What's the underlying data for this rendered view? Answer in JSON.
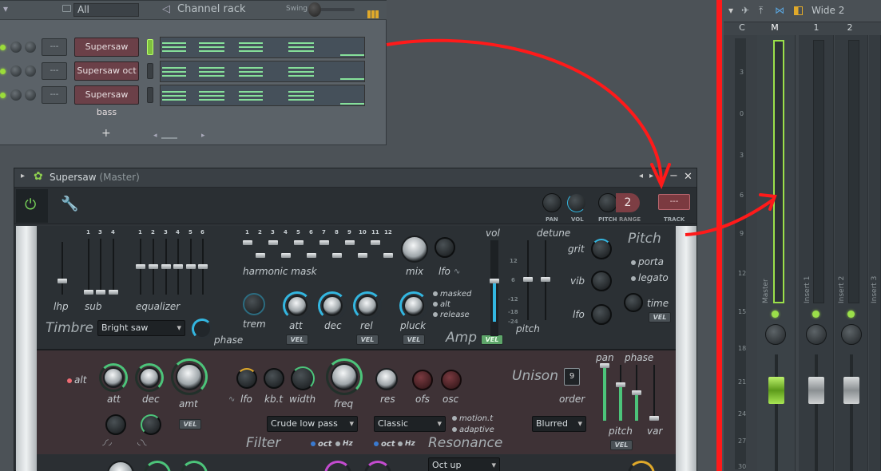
{
  "channel_rack": {
    "filter": "All",
    "title": "Channel rack",
    "swing_label": "Swing",
    "add_label": "+",
    "channels": [
      {
        "mixer_track": "---",
        "name": "Supersaw",
        "selected": true
      },
      {
        "mixer_track": "---",
        "name": "Supersaw oct",
        "selected": false
      },
      {
        "mixer_track": "---",
        "name": "Supersaw bass",
        "selected": false
      }
    ]
  },
  "plugin": {
    "name": "Supersaw",
    "context": "(Master)",
    "toolbar": {
      "pan_label": "PAN",
      "vol_label": "VOL",
      "pitch_label": "PITCH",
      "range_label": "RANGE",
      "range_value": "2",
      "track_value": "---",
      "track_label": "TRACK"
    },
    "timbre": {
      "section_label": "Timbre",
      "lhp_label": "lhp",
      "sub_label": "sub",
      "sub_ticks": [
        "1",
        "3",
        "4"
      ],
      "eq_label": "equalizer",
      "eq_ticks": [
        "1",
        "2",
        "3",
        "4",
        "5",
        "6"
      ],
      "harmonic_mask_label": "harmonic mask",
      "harmonic_ticks": [
        "1",
        "2",
        "3",
        "4",
        "5",
        "6",
        "7",
        "8",
        "9",
        "10",
        "11",
        "12"
      ],
      "preset": "Bright saw",
      "phase_label": "phase",
      "mix_label": "mix",
      "lfo_label": "lfo"
    },
    "amp": {
      "section_label": "Amp",
      "trem_label": "trem",
      "att_label": "att",
      "dec_label": "dec",
      "rel_label": "rel",
      "pluck_label": "pluck",
      "vel_label": "VEL",
      "options": [
        "masked",
        "alt",
        "release"
      ],
      "vol_label": "vol",
      "detune_label": "detune",
      "pitch_label": "pitch",
      "scale": [
        "12",
        "6",
        "-12",
        "-18",
        "-24"
      ]
    },
    "pitch": {
      "section_label": "Pitch",
      "grit_label": "grit",
      "vib_label": "vib",
      "lfo_label": "lfo",
      "porta_label": "porta",
      "legato_label": "legato",
      "time_label": "time",
      "vel_label": "VEL"
    },
    "filter": {
      "alt_label": "alt",
      "att_label": "att",
      "dec_label": "dec",
      "amt_label": "amt",
      "vel_label": "VEL",
      "lfo_label": "lfo",
      "kbt_label": "kb.t",
      "width_label": "width",
      "freq_label": "freq",
      "res_label": "res",
      "ofs_label": "ofs",
      "osc_label": "osc",
      "type": "Crude low pass",
      "section_label": "Filter",
      "oct_label": "oct",
      "hz_label": "Hz",
      "resonance_type": "Classic",
      "motion_label": "motion.t",
      "adaptive_label": "adaptive",
      "resonance_label": "Resonance"
    },
    "unison": {
      "section_label": "Unison",
      "order_value": "9",
      "order_label": "order",
      "mode": "Blurred",
      "pan_label": "pan",
      "phase_label": "phase",
      "pitch_label": "pitch",
      "var_label": "var",
      "vel_label": "VEL"
    },
    "bottom": {
      "dropdown": "Oct up"
    }
  },
  "mixer": {
    "preset": "Wide 2",
    "headers": [
      "C",
      "M",
      "1",
      "2"
    ],
    "scale": [
      "3",
      "0",
      "3",
      "6",
      "9",
      "12",
      "15",
      "18",
      "21",
      "24",
      "27",
      "30"
    ],
    "strips": [
      {
        "label": "Master"
      },
      {
        "label": "Insert 1"
      },
      {
        "label": "Insert 2"
      },
      {
        "label": "Insert 3"
      }
    ]
  },
  "colors": {
    "annotation": "#ff1a1a",
    "accent_green": "#9bdc3a",
    "channel_name_bg": "#6b4048"
  }
}
